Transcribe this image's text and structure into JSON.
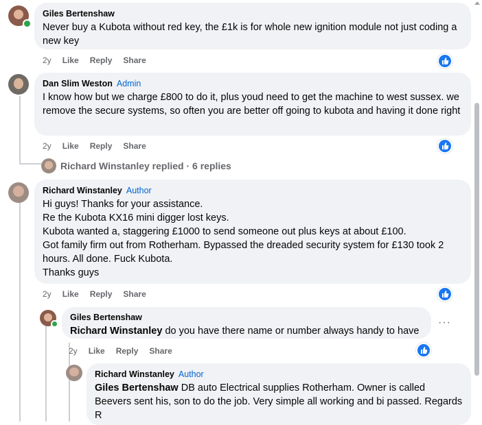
{
  "comments": [
    {
      "author": "Giles Bertenshaw",
      "badge": "",
      "text": "Never buy a Kubota without red key, the £1k is for whole new ignition module not just coding a new key",
      "time": "2y",
      "like": "Like",
      "reply": "Reply",
      "share": "Share"
    },
    {
      "author": "Dan Slim Weston",
      "badge": "Admin",
      "text": "I know how but we charge £800 to do it, plus youd need to get the machine to west sussex. we remove the secure systems, so often you are better off going to kubota and having it done right",
      "time": "2y",
      "like": "Like",
      "reply": "Reply",
      "share": "Share",
      "replies_summary": "Richard Winstanley replied · 6 replies"
    },
    {
      "author": "Richard Winstanley",
      "badge": "Author",
      "lines": [
        "Hi guys! Thanks for your assistance.",
        "Re the Kubota KX16 mini digger lost keys.",
        "Kubota wanted a, staggering £1000 to send someone out plus keys at about £100.",
        "Got family firm out from Rotherham. Bypassed the dreaded security system for £130 took 2 hours. All done. Fuck Kubota.",
        "Thanks guys"
      ],
      "time": "2y",
      "like": "Like",
      "reply": "Reply",
      "share": "Share"
    },
    {
      "author": "Giles Bertenshaw",
      "badge": "",
      "mention": "Richard Winstanley",
      "text": " do you have there name or number always handy to have",
      "time": "2y",
      "like": "Like",
      "reply": "Reply",
      "share": "Share",
      "more": "···"
    },
    {
      "author": "Richard Winstanley",
      "badge": "Author",
      "mention": "Giles Bertenshaw",
      "text": " DB auto Electrical supplies Rotherham. Owner is called Beevers sent his, son to do the job. Very simple all working and bi passed. Regards R"
    }
  ],
  "colors": {
    "like_blue": "#1877f2",
    "badge_blue": "#0064d1",
    "bubble": "#f0f2f5",
    "online": "#31a24c"
  },
  "icons": {
    "like_badge": "thumbs-up-icon",
    "more": "more-options-icon"
  }
}
